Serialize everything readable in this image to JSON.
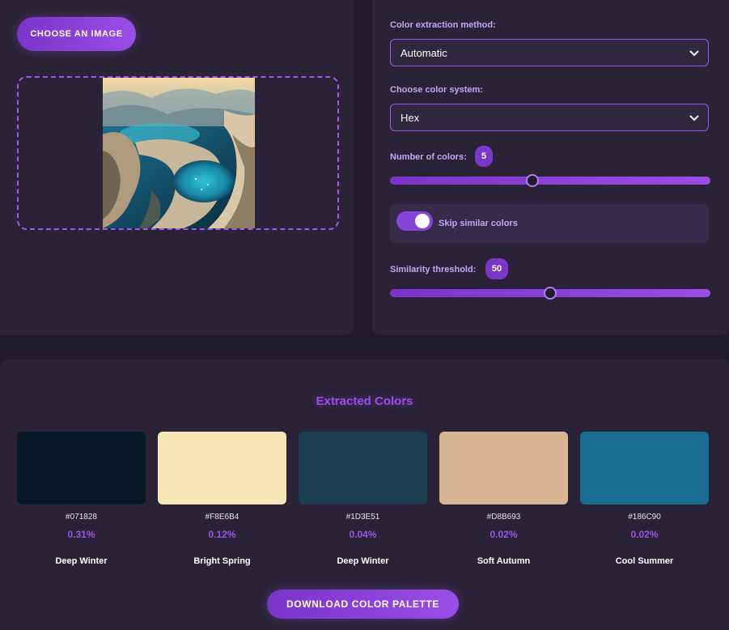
{
  "image_panel": {
    "choose_button": "CHOOSE AN IMAGE"
  },
  "settings": {
    "method_label": "Color extraction method:",
    "method_value": "Automatic",
    "system_label": "Choose color system:",
    "system_value": "Hex",
    "count_label": "Number of colors:",
    "count_value": "5",
    "count_slider": {
      "min": 1,
      "max": 10,
      "value": 5
    },
    "skip_label": "Skip similar colors",
    "skip_enabled": true,
    "threshold_label": "Similarity threshold:",
    "threshold_value": "50",
    "threshold_slider": {
      "min": 0,
      "max": 100,
      "value": 50
    }
  },
  "results": {
    "title": "Extracted Colors",
    "colors": [
      {
        "hex": "#071828",
        "percent": "0.31%",
        "season": "Deep Winter"
      },
      {
        "hex": "#F8E6B4",
        "percent": "0.12%",
        "season": "Bright Spring"
      },
      {
        "hex": "#1D3E51",
        "percent": "0.04%",
        "season": "Deep Winter"
      },
      {
        "hex": "#D8B693",
        "percent": "0.02%",
        "season": "Soft Autumn"
      },
      {
        "hex": "#186C90",
        "percent": "0.02%",
        "season": "Cool Summer"
      }
    ],
    "download_button": "DOWNLOAD COLOR PALETTE"
  },
  "colors": {
    "accent": "#9b4de6",
    "background": "#1f1b2b",
    "panel": "#2a2338"
  },
  "icons": [
    "chevron-down-icon",
    "landscape-image"
  ]
}
